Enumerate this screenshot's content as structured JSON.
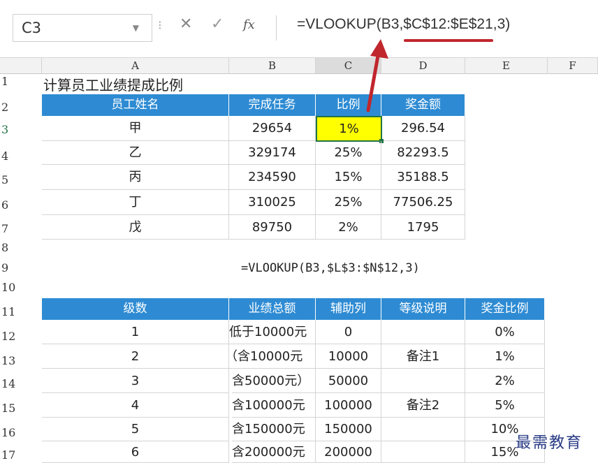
{
  "formula_bar": {
    "name_box": "C3",
    "cancel_icon": "✕",
    "enter_icon": "✓",
    "fx_label": "fx",
    "formula": "=VLOOKUP(B3,$C$12:$E$21,3)"
  },
  "columns": [
    "A",
    "B",
    "C",
    "D",
    "E",
    "F"
  ],
  "rows": [
    "1",
    "2",
    "3",
    "4",
    "5",
    "6",
    "7",
    "8",
    "9",
    "10",
    "11",
    "12",
    "13",
    "14",
    "15",
    "16",
    "17"
  ],
  "title": "计算员工业绩提成比例",
  "table1": {
    "headers": [
      "员工姓名",
      "完成任务",
      "比例",
      "奖金额"
    ],
    "rows": [
      [
        "甲",
        "29654",
        "1%",
        "296.54"
      ],
      [
        "乙",
        "329174",
        "25%",
        "82293.5"
      ],
      [
        "丙",
        "234590",
        "15%",
        "35188.5"
      ],
      [
        "丁",
        "310025",
        "25%",
        "77506.25"
      ],
      [
        "戊",
        "89750",
        "2%",
        "1795"
      ]
    ]
  },
  "note_formula": "=VLOOKUP(B3,$L$3:$N$12,3)",
  "table2": {
    "headers": [
      "级数",
      "业绩总额",
      "辅助列",
      "等级说明",
      "奖金比例"
    ],
    "rows": [
      [
        "1",
        "低于10000元",
        "0",
        "",
        "0%"
      ],
      [
        "2",
        "（含10000元",
        "10000",
        "备注1",
        "1%"
      ],
      [
        "3",
        "含50000元）",
        "50000",
        "",
        "2%"
      ],
      [
        "4",
        "含100000元",
        "100000",
        "备注2",
        "5%"
      ],
      [
        "5",
        "含150000元",
        "150000",
        "",
        "10%"
      ],
      [
        "6",
        "含200000元",
        "200000",
        "",
        "15%"
      ]
    ]
  },
  "watermark": "最需教育",
  "colors": {
    "header_blue": "#2e8bd3",
    "selection_yellow": "#ffff00",
    "annotation_red": "#c0272d",
    "excel_green": "#217346"
  }
}
